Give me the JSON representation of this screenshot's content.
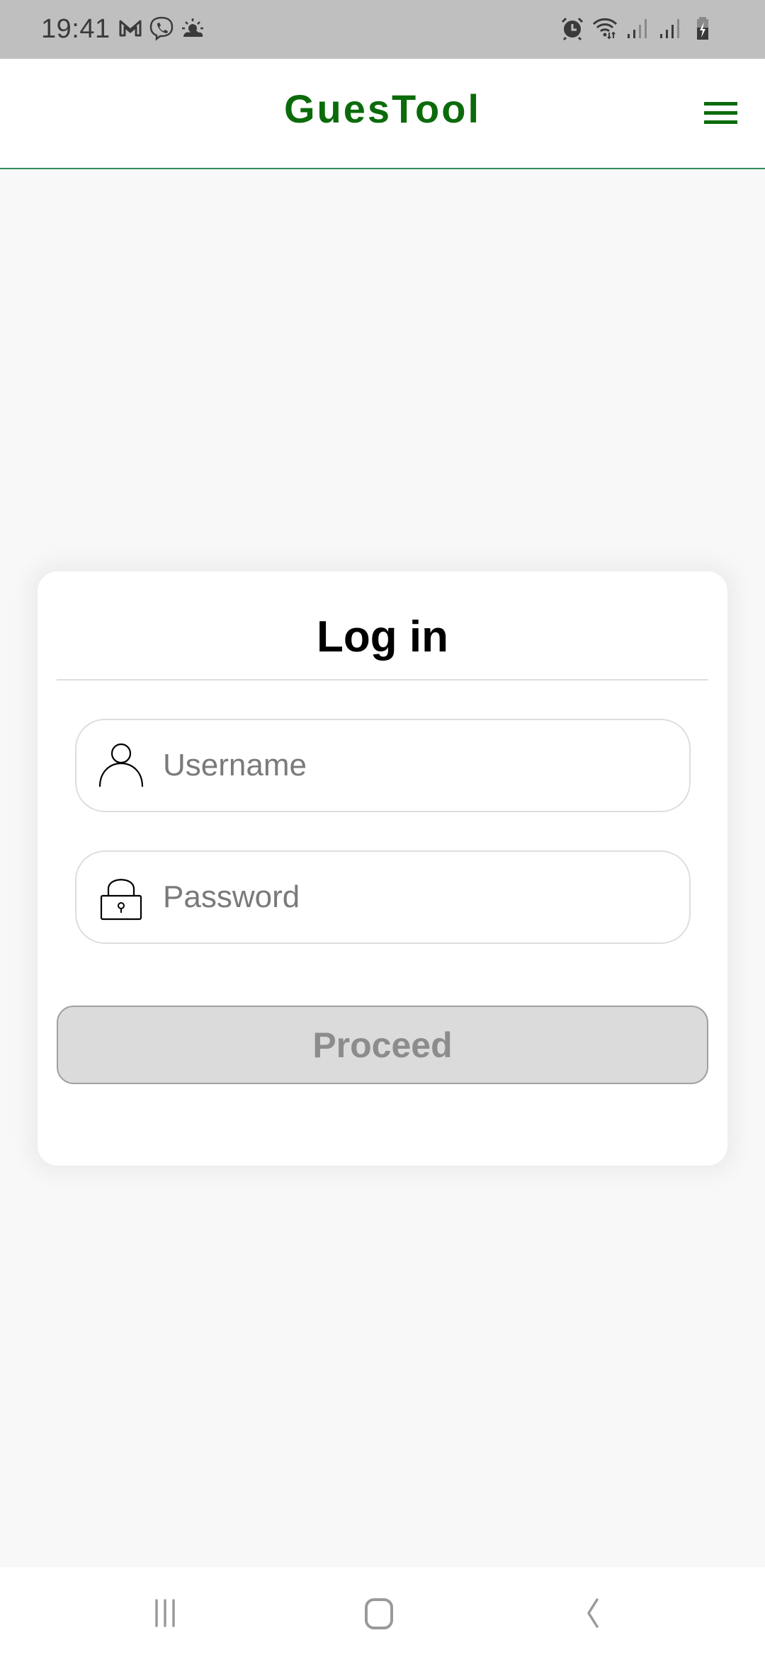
{
  "status_bar": {
    "time": "19:41",
    "left_icons": [
      "gmail-icon",
      "viber-icon",
      "weather-icon"
    ],
    "right_icons": [
      "alarm-icon",
      "wifi-icon",
      "signal-icon",
      "signal-icon",
      "battery-charging-icon"
    ]
  },
  "header": {
    "title": "GuesTool",
    "menu_icon": "hamburger-menu-icon",
    "accent_color": "#0b6b0b",
    "divider_color": "#2e8b57"
  },
  "login_card": {
    "title": "Log in",
    "username": {
      "icon": "user-icon",
      "value": "",
      "placeholder": "Username"
    },
    "password": {
      "icon": "lock-icon",
      "value": "",
      "placeholder": "Password"
    },
    "proceed_label": "Proceed",
    "proceed_state": "disabled"
  },
  "nav_bar": {
    "buttons": [
      "recent-apps",
      "home",
      "back"
    ]
  }
}
